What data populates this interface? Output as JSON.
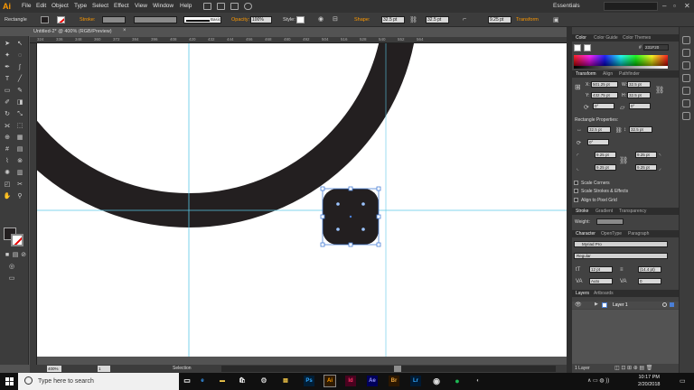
{
  "app": {
    "logo": "Ai",
    "workspace": "Essentials"
  },
  "menu": [
    "File",
    "Edit",
    "Object",
    "Type",
    "Select",
    "Effect",
    "View",
    "Window",
    "Help"
  ],
  "control_bar": {
    "selection_type": "Rectangle",
    "stroke_label": "Stroke:",
    "brush_label": "Basic",
    "opacity_label": "Opacity:",
    "opacity_value": "100%",
    "style_label": "Style:",
    "shape_label": "Shape:",
    "shape_w": "32.5 pt",
    "shape_h": "32.5 pt",
    "corner_value": "9.25 pt",
    "transform_label": "Transform"
  },
  "document": {
    "tab_title": "Untitled-2* @ 400% (RGB/Preview)",
    "tab_close": "×"
  },
  "rulers": {
    "top": [
      "324",
      "336",
      "348",
      "360",
      "372",
      "384",
      "396",
      "408",
      "420",
      "432",
      "444",
      "456",
      "468",
      "480",
      "492",
      "504",
      "516",
      "528",
      "540",
      "552",
      "564"
    ]
  },
  "status": {
    "zoom": "400%",
    "artboard": "1",
    "tool": "Selection"
  },
  "panels": {
    "color_tabs": [
      "Color",
      "Color Guide",
      "Color Themes"
    ],
    "hex_symbol": "#",
    "hex": "231F20",
    "transform_tabs": [
      "Transform",
      "Align",
      "Pathfinder"
    ],
    "x_label": "X:",
    "x": "501.25 pt",
    "y_label": "Y:",
    "y": "432.75 pt",
    "w_label": "W:",
    "w": "32.5 pt",
    "h_label": "H:",
    "h": "32.5 pt",
    "rotate": "0°",
    "shear": "0°",
    "rect_props_title": "Rectangle Properties:",
    "rect_w": "32.5 pt",
    "rect_h": "32.5 pt",
    "rect_angle": "0°",
    "corners": [
      "9.25 pt",
      "9.25 pt",
      "9.25 pt",
      "9.25 pt"
    ],
    "checkboxes": [
      "Scale Corners",
      "Scale Strokes & Effects",
      "Align to Pixel Grid"
    ],
    "stroke_tabs": [
      "Stroke",
      "Gradient",
      "Transparency"
    ],
    "weight_label": "Weight:",
    "char_tabs": [
      "Character",
      "OpenType",
      "Paragraph"
    ],
    "font_family": "Myriad Pro",
    "font_style": "Regular",
    "font_size": "12 pt",
    "leading": "(14.4 pt)",
    "kerning": "Auto",
    "tracking": "0",
    "layers_tabs": [
      "Layers",
      "Artboards"
    ],
    "layer_name": "Layer 1",
    "layer_count": "1 Layer"
  },
  "taskbar": {
    "search_placeholder": "Type here to search",
    "apps": [
      "Ps",
      "Ai",
      "Id",
      "Ae",
      "Br",
      "Lr"
    ],
    "time": "10:17 PM",
    "date": "2/20/2018"
  },
  "colors": {
    "fill": "#231F20",
    "guide": "#5ac8e6",
    "selection": "#4a7fd6",
    "ai_orange": "#ff9a00"
  }
}
